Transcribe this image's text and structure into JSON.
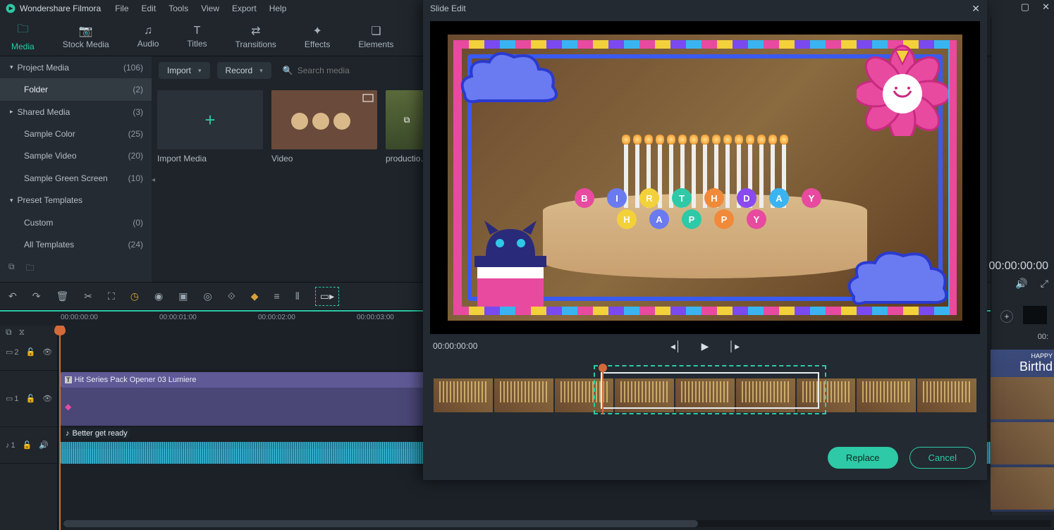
{
  "app": {
    "title": "Wondershare Filmora"
  },
  "menu": {
    "file": "File",
    "edit": "Edit",
    "tools": "Tools",
    "view": "View",
    "export": "Export",
    "help": "Help"
  },
  "tabs": {
    "media": "Media",
    "stock": "Stock Media",
    "audio": "Audio",
    "titles": "Titles",
    "transitions": "Transitions",
    "effects": "Effects",
    "elements": "Elements"
  },
  "sidebar": {
    "project_media": {
      "label": "Project Media",
      "count": "(106)"
    },
    "folder": {
      "label": "Folder",
      "count": "(2)"
    },
    "shared_media": {
      "label": "Shared Media",
      "count": "(3)"
    },
    "sample_color": {
      "label": "Sample Color",
      "count": "(25)"
    },
    "sample_video": {
      "label": "Sample Video",
      "count": "(20)"
    },
    "sample_green": {
      "label": "Sample Green Screen",
      "count": "(10)"
    },
    "preset_templates": {
      "label": "Preset Templates"
    },
    "custom": {
      "label": "Custom",
      "count": "(0)"
    },
    "all_templates": {
      "label": "All Templates",
      "count": "(24)"
    }
  },
  "media_toolbar": {
    "import": "Import",
    "record": "Record",
    "search_placeholder": "Search media"
  },
  "media_cards": {
    "import": "Import Media",
    "video": "Video",
    "production": "productio…"
  },
  "timeline": {
    "rulers": [
      "00:00:00:00",
      "00:00:01:00",
      "00:00:02:00",
      "00:00:03:00"
    ],
    "title_clip": "Hit Series Pack Opener 03 Lumiere",
    "audio_clip": "Better get ready",
    "track_labels": {
      "v2": "2",
      "v1": "1",
      "a1": "1"
    }
  },
  "right": {
    "timecode": "00:00:00:00",
    "timecode2": "00:"
  },
  "dialog": {
    "title": "Slide Edit",
    "timecode": "00:00:00:00",
    "replace": "Replace",
    "cancel": "Cancel",
    "letters": [
      "B",
      "I",
      "R",
      "T",
      "H",
      "D",
      "A",
      "Y",
      "H",
      "A",
      "P",
      "P",
      "Y"
    ]
  },
  "right_strip": {
    "happy": "HAPPY",
    "birthday": "Birthd"
  }
}
